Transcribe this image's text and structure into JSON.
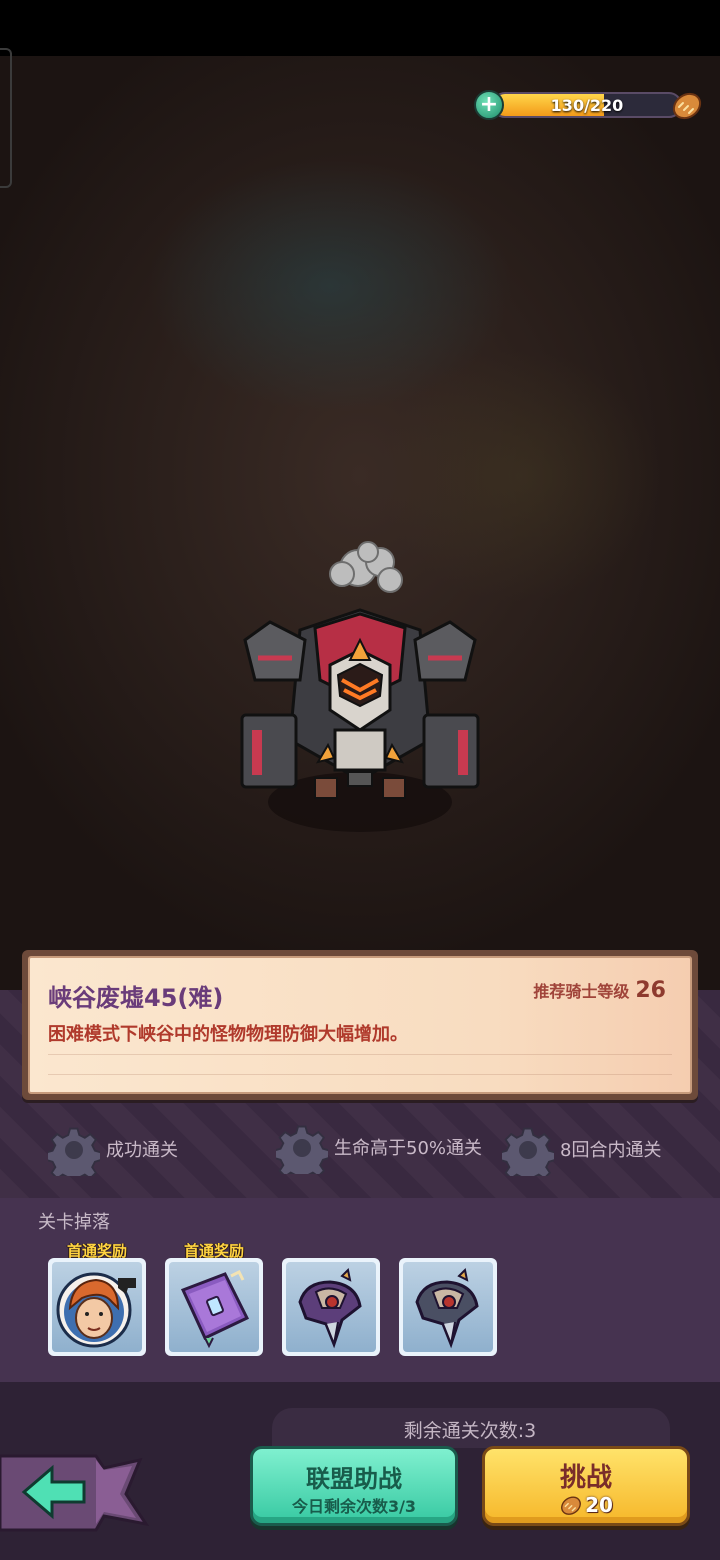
{
  "energy": {
    "value_text": "130/220",
    "current": 130,
    "max": 220,
    "plus_icon": "plus-icon",
    "bread_icon": "bread-icon"
  },
  "stage": {
    "title": "峡谷废墟45(难)",
    "recommend_label": "推荐骑士等级",
    "recommend_level": "26",
    "description": "困难模式下峡谷中的怪物物理防御大幅增加。"
  },
  "conditions": [
    {
      "icon": "gear-icon",
      "text": "成功通关"
    },
    {
      "icon": "gear-icon",
      "text": "生命高于50%通关"
    },
    {
      "icon": "gear-icon",
      "text": "8回合内通关"
    }
  ],
  "drops": {
    "title": "关卡掉落",
    "items": [
      {
        "tag": "首通奖励",
        "icon": "hero-portrait-icon"
      },
      {
        "tag": "首通奖励",
        "icon": "spellbook-icon"
      },
      {
        "tag": "",
        "icon": "armor-piece-icon"
      },
      {
        "tag": "",
        "icon": "armor-piece-icon"
      }
    ]
  },
  "remaining_clears": "剩余通关次数:3",
  "buttons": {
    "alliance_label": "联盟助战",
    "alliance_sub": "今日剩余次数3/3",
    "challenge_label": "挑战",
    "challenge_cost": "20"
  },
  "colors": {
    "green_button": "#37c9a2",
    "yellow_button": "#f6b72a",
    "panel": "#3b2a42"
  }
}
